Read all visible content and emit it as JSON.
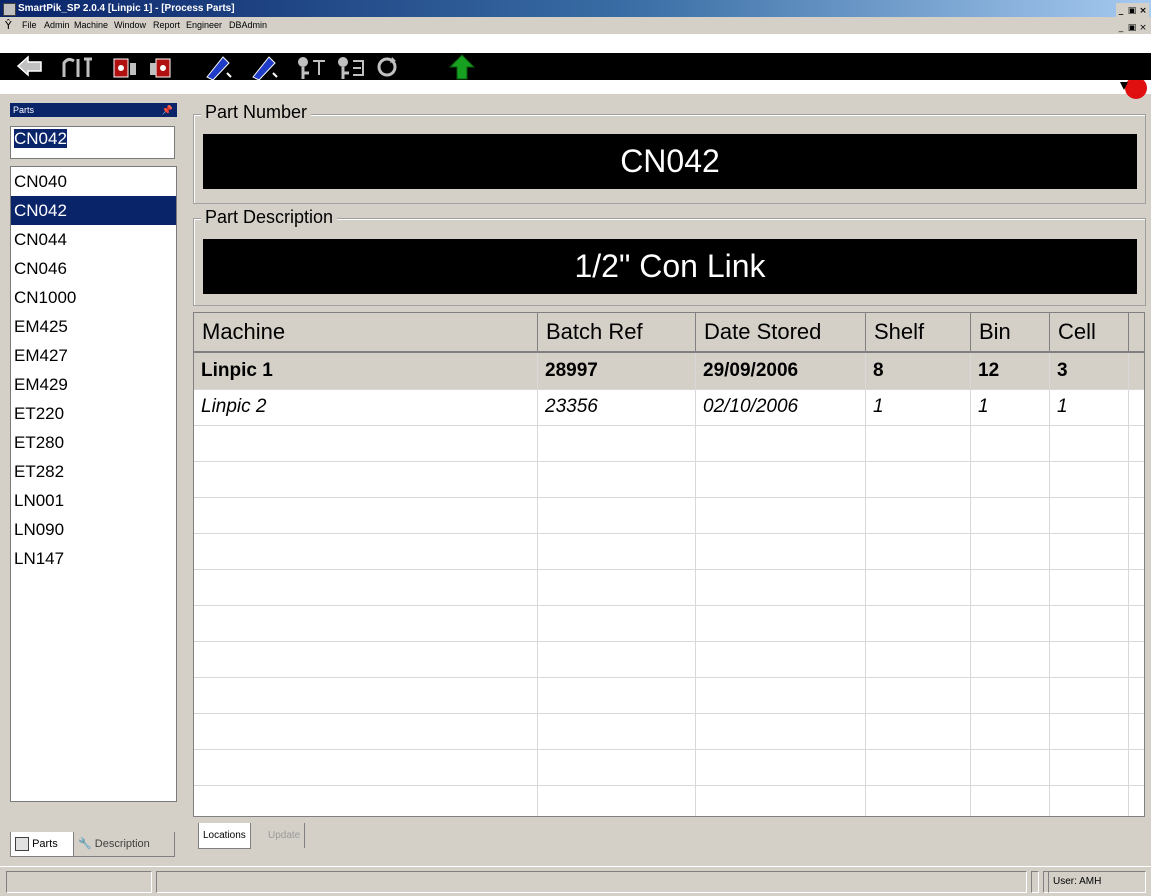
{
  "window": {
    "title": "SmartPik_SP 2.0.4 [Linpic 1] - [Process Parts]",
    "controls": [
      "_",
      " ",
      "×"
    ]
  },
  "menu": {
    "items": [
      "File",
      "Admin",
      "Machine",
      "Window",
      "Report",
      "Engineer",
      "DBAdmin"
    ]
  },
  "toolbar": {
    "buttons": [
      "back-icon",
      "tools-icon",
      "lift-icon",
      "lift-alt-icon",
      "pen-icon",
      "pen-alt-icon",
      "key-icon",
      "key-alt-icon",
      "refresh-icon",
      "up-arrow-icon"
    ],
    "right_icon": "alert-icon"
  },
  "parts_panel": {
    "header": "Parts",
    "search_value": "CN042",
    "items": [
      "CN040",
      "CN042",
      "CN044",
      "CN046",
      "CN1000",
      "EM425",
      "EM427",
      "EM429",
      "ET220",
      "ET280",
      "ET282",
      "LN001",
      "LN090",
      "LN147"
    ],
    "selected": "CN042",
    "tabs": [
      "Parts",
      "Description"
    ]
  },
  "part_number": {
    "label": "Part Number",
    "value": "CN042"
  },
  "part_description": {
    "label": "Part Description",
    "value": "1/2\" Con Link"
  },
  "locations_table": {
    "columns": [
      "Machine",
      "Batch Ref",
      "Date Stored",
      "Shelf",
      "Bin",
      "Cell"
    ],
    "rows": [
      [
        "Linpic 1",
        "28997",
        "29/09/2006",
        "8",
        "12",
        "3"
      ],
      [
        "Linpic 2",
        "23356",
        "02/10/2006",
        "1",
        "1",
        "1"
      ]
    ]
  },
  "bottom_tabs": [
    "Locations",
    "Update"
  ],
  "status": {
    "user": "User: AMH"
  },
  "colors": {
    "selection": "#0a246a",
    "chrome": "#d4d0c8",
    "display_bg": "#000000",
    "display_fg": "#ffffff"
  }
}
